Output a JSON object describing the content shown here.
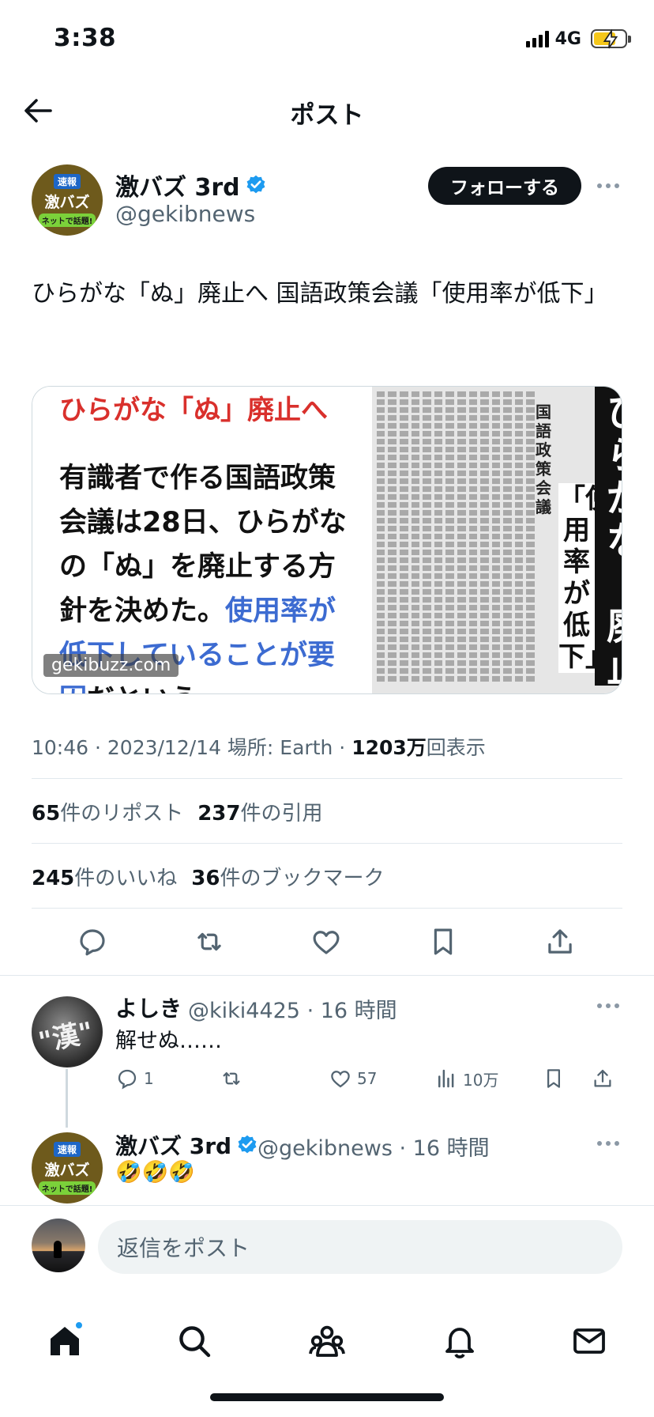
{
  "status_bar": {
    "time": "3:38",
    "network": "4G"
  },
  "header": {
    "title": "ポスト"
  },
  "author": {
    "avatar_badge": "速報",
    "avatar_text": "激バズ",
    "avatar_sub": "ネットで話題!",
    "name": "激バズ 3rd",
    "handle": "@gekibnews",
    "follow_label": "フォローする"
  },
  "post": {
    "text": "ひらがな「ぬ」廃止へ 国語政策会議「使用率が低下」",
    "image": {
      "headline": "ひらがな「ぬ」廃止へ",
      "body_black": "有識者で作る国語政策会議は28日、ひらがなの「ぬ」を廃止する方針を決めた。",
      "body_blue": "使用率が低下している",
      "body_tail": "だという。",
      "body_blue2": "ことが要因",
      "news_sub": "国語政策会議",
      "news_box": "「使用率が低下」",
      "news_headline": "ひらがな「ぬ」廃止へ",
      "watermark": "gekibuzz.com"
    },
    "meta": {
      "time": "10:46 · 2023/12/14 場所: Earth · ",
      "views": "1203万",
      "views_label": "回表示"
    },
    "stats": {
      "reposts": "65",
      "reposts_label": "件のリポスト",
      "quotes": "237",
      "quotes_label": "件の引用",
      "likes": "245",
      "likes_label": "件のいいね",
      "bookmarks": "36",
      "bookmarks_label": "件のブックマーク"
    }
  },
  "replies": [
    {
      "name": "よしき",
      "handle": "@kiki4425 · 16 時間",
      "text": "解せぬ……",
      "reply_count": "1",
      "like_count": "57",
      "view_count": "10万"
    },
    {
      "name": "激バズ 3rd",
      "handle": "@gekibnews · 16 時間",
      "text": "🤣🤣🤣"
    }
  ],
  "reply_box": {
    "placeholder": "返信をポスト"
  },
  "colors": {
    "accent": "#1d9bf0",
    "text": "#0f1419",
    "muted": "#536471"
  }
}
